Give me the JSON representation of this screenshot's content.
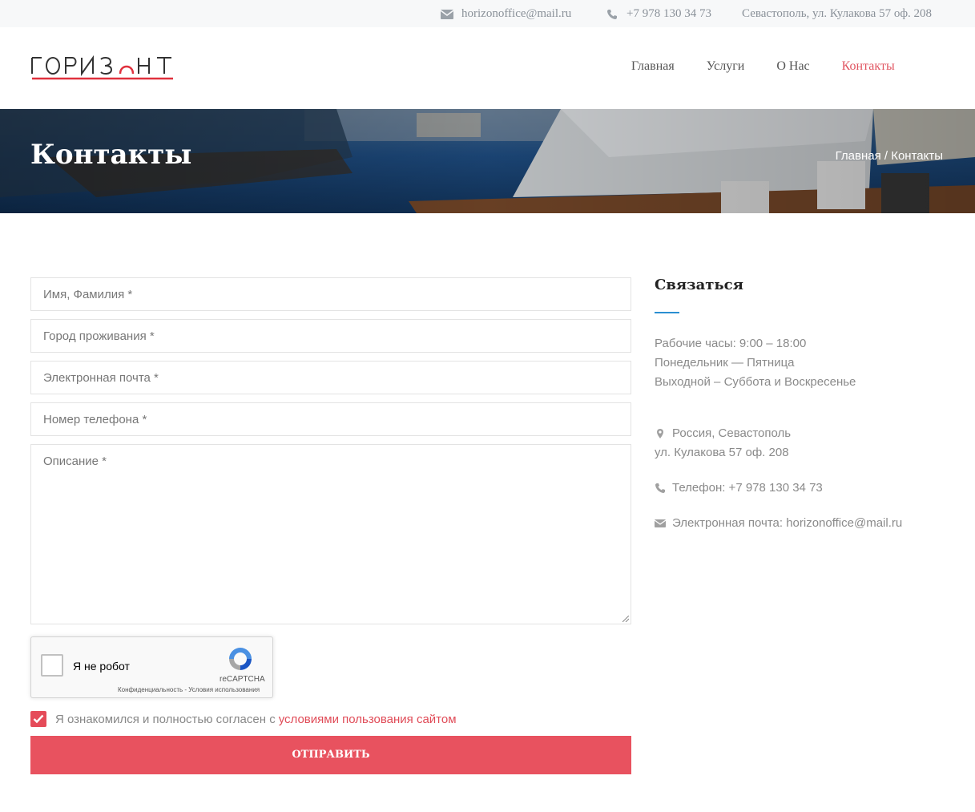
{
  "topbar": {
    "email": "horizonoffice@mail.ru",
    "phone": "+7 978 130 34 73",
    "address": "Севастополь, ул. Кулакова 57 оф. 208"
  },
  "logo": {
    "text": "ГОРИЗОНТ",
    "color": "#e0313e"
  },
  "nav": {
    "items": [
      {
        "label": "Главная"
      },
      {
        "label": "Услуги"
      },
      {
        "label": "О Нас"
      },
      {
        "label": "Контакты",
        "active": true
      }
    ]
  },
  "banner": {
    "title": "Контакты",
    "breadcrumb": "Главная / Контакты"
  },
  "form": {
    "name_placeholder": "Имя, Фамилия *",
    "city_placeholder": "Город проживания *",
    "email_placeholder": "Электронная почта *",
    "phone_placeholder": "Номер телефона *",
    "description_placeholder": "Описание *",
    "captcha": {
      "label": "Я не робот",
      "brand": "reCAPTCHA",
      "links": "Конфиденциальность - Условия использования"
    },
    "agree_text": "Я ознакомился и полностью согласен с",
    "agree_link": "условиями пользования сайтом",
    "agree_checked": true,
    "submit_label": "ОТПРАВИТЬ"
  },
  "sidebar": {
    "title": "Связаться",
    "hours": "Рабочие часы: 9:00 – 18:00",
    "days": "Понедельник — Пятница",
    "weekend": "Выходной – Суббота и Воскресенье",
    "address_line1": "Россия, Севастополь",
    "address_line2": "ул. Кулакова 57 оф. 208",
    "phone": "Телефон: +7 978 130 34 73",
    "email": "Электронная почта: horizonoffice@mail.ru"
  },
  "colors": {
    "accent": "#e8525f",
    "link_active": "#e05460",
    "divider_blue": "#2a8fd1"
  }
}
